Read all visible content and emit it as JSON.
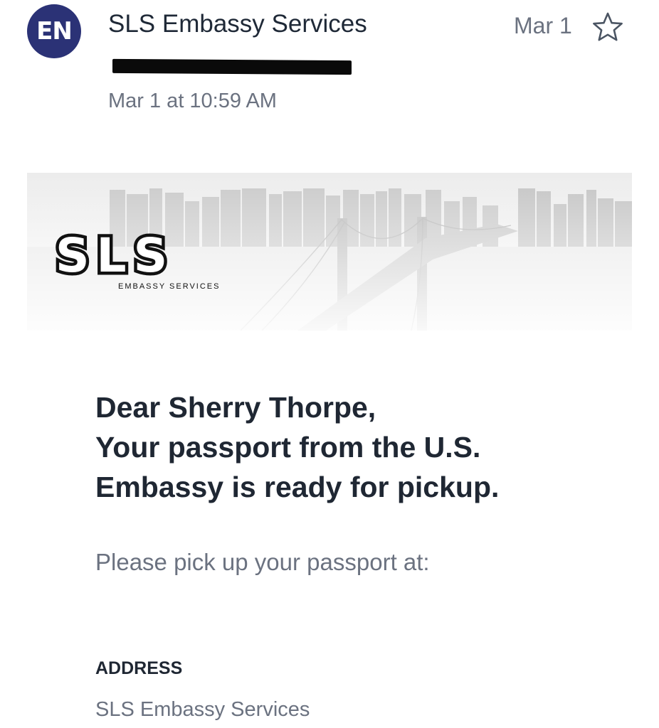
{
  "header": {
    "avatar_initials": "EN",
    "avatar_color": "#2b3276",
    "sender_name": "SLS Embassy Services",
    "date": "Mar 1",
    "star_icon": "star-outline-icon",
    "recipient_redacted": true,
    "timestamp": "Mar 1 at 10:59 AM"
  },
  "banner": {
    "logo_text": "SLS",
    "logo_subtitle": "EMBASSY SERVICES",
    "image": "city-skyline-bridge-image"
  },
  "body": {
    "headline_lines": [
      "Dear Sherry Thorpe,",
      "Your passport from the U.S.",
      "Embassy is ready for pickup."
    ],
    "pickup_text": "Please pick up your passport at:",
    "address_label": "ADDRESS",
    "address_value": "SLS Embassy Services"
  },
  "colors": {
    "heading_text": "#1f2733",
    "muted_text": "#6b7280"
  }
}
